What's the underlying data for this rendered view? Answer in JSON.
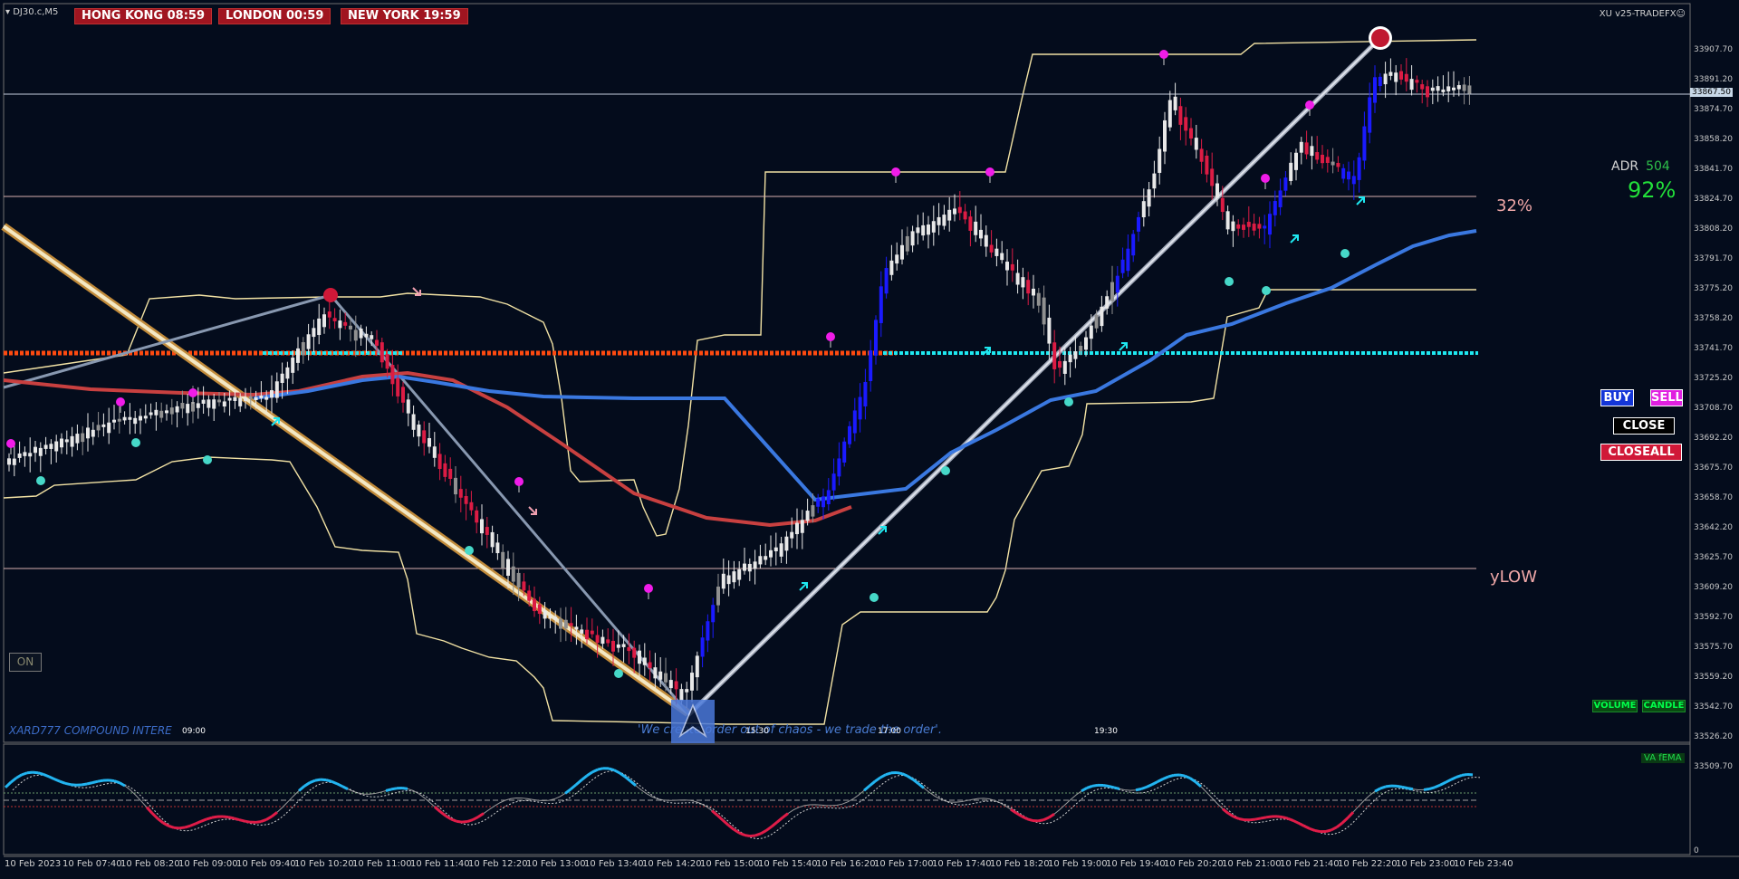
{
  "header": {
    "symbol": "DJ30.c,M5",
    "clocks": [
      {
        "label": "HONG KONG 08:59"
      },
      {
        "label": "LONDON  00:59"
      },
      {
        "label": "NEW YORK  19:59"
      }
    ],
    "indicator_title": "XU v25-TRADEFX☺"
  },
  "adr": {
    "label": "ADR",
    "value": "504",
    "percent": "92%"
  },
  "trade_buttons": {
    "buy": "BUY",
    "sell": "SELL",
    "close": "CLOSE",
    "closeall": "CLOSEALL"
  },
  "toggles": {
    "on": "ON",
    "volume": "VOLUME",
    "candle": "CANDLE"
  },
  "levels": {
    "pct_label": "32%",
    "ylow_label": "yLOW"
  },
  "footer_text": {
    "compound": "XARD777 COMPOUND INTERE",
    "quote": "'We create order out of chaos - we trade the order'."
  },
  "time_marks": [
    {
      "label": "09:00",
      "color": "#c8283a"
    },
    {
      "label": "15:30",
      "color": "#c8283a"
    },
    {
      "label": "17:00",
      "color": "#c8283a"
    },
    {
      "label": "19:30",
      "color": "#e08a20"
    }
  ],
  "oscillator": {
    "label": "VA fEMA",
    "scale_top": "",
    "scale_bottom": "0"
  },
  "price_axis": {
    "current": "33867.50",
    "labels": [
      "33907.70",
      "33891.20",
      "33874.70",
      "33858.20",
      "33841.70",
      "33824.70",
      "33808.20",
      "33791.70",
      "33775.20",
      "33758.20",
      "33741.70",
      "33725.20",
      "33708.70",
      "33692.20",
      "33675.70",
      "33658.70",
      "33642.20",
      "33625.70",
      "33609.20",
      "33592.70",
      "33575.70",
      "33559.20",
      "33542.70",
      "33526.20",
      "33509.70"
    ]
  },
  "time_axis": [
    "10 Feb 2023",
    "10 Feb 07:40",
    "10 Feb 08:20",
    "10 Feb 09:00",
    "10 Feb 09:40",
    "10 Feb 10:20",
    "10 Feb 11:00",
    "10 Feb 11:40",
    "10 Feb 12:20",
    "10 Feb 13:00",
    "10 Feb 13:40",
    "10 Feb 14:20",
    "10 Feb 15:00",
    "10 Feb 15:40",
    "10 Feb 16:20",
    "10 Feb 17:00",
    "10 Feb 17:40",
    "10 Feb 18:20",
    "10 Feb 19:00",
    "10 Feb 19:40",
    "10 Feb 20:20",
    "10 Feb 21:00",
    "10 Feb 21:40",
    "10 Feb 22:20",
    "10 Feb 23:00",
    "10 Feb 23:40"
  ],
  "colors": {
    "background": "#040c1c",
    "bull_candle": "#e8e8e8",
    "bear_candle": "#dc1c44",
    "impulse_up": "#1a1aff",
    "neutral_candle": "#909090",
    "envelope": "#f2e2a4",
    "ema_blue": "#3a78e0",
    "ema_red": "#c84040",
    "orange_level": "#ff4a10",
    "cyan_level": "#1ee8f0",
    "magenta_dot": "#f01ce8",
    "teal_dot": "#46d8c8"
  },
  "chart_data": {
    "type": "candlestick",
    "x": [
      "10 Feb 07:00",
      "10 Feb 07:40",
      "10 Feb 08:20",
      "10 Feb 09:00",
      "10 Feb 09:40",
      "10 Feb 10:20",
      "10 Feb 11:00",
      "10 Feb 11:40",
      "10 Feb 12:20",
      "10 Feb 13:00",
      "10 Feb 13:40",
      "10 Feb 14:20",
      "10 Feb 15:00",
      "10 Feb 15:40",
      "10 Feb 16:20",
      "10 Feb 17:00",
      "10 Feb 17:40",
      "10 Feb 18:20",
      "10 Feb 19:00",
      "10 Feb 19:40",
      "10 Feb 20:20",
      "10 Feb 21:00",
      "10 Feb 21:40",
      "10 Feb 22:20",
      "10 Feb 23:00",
      "10 Feb 23:40"
    ],
    "close": [
      33665,
      33690,
      33695,
      33702,
      33735,
      33745,
      33730,
      33640,
      33610,
      33578,
      33560,
      33540,
      33605,
      33630,
      33680,
      33770,
      33760,
      33770,
      33740,
      33800,
      33830,
      33790,
      33810,
      33862,
      33868,
      33867
    ],
    "ylim": [
      33505,
      33910
    ],
    "levels": {
      "orange": 33725,
      "cyan": 33725,
      "pct32": 33808,
      "ylow": 33605
    }
  }
}
